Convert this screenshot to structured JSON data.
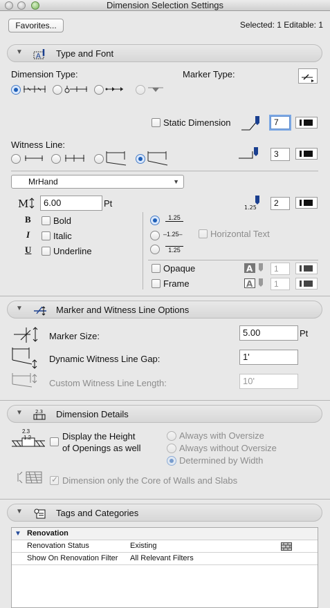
{
  "window": {
    "title": "Dimension Selection Settings"
  },
  "toolbar": {
    "favorites_label": "Favorites...",
    "selection_info": "Selected: 1 Editable: 1"
  },
  "type_font": {
    "title": "Type and Font",
    "dimension_type_label": "Dimension Type:",
    "marker_type_label": "Marker Type:",
    "static_dimension_label": "Static Dimension",
    "static_pen": "7",
    "witness_line_label": "Witness Line:",
    "witness_pen": "3",
    "font_name": "MrHand",
    "font_size": "6.00",
    "font_unit": "Pt",
    "text_pen": "2",
    "bold_label": "Bold",
    "italic_label": "Italic",
    "underline_label": "Underline",
    "sample_value": "1.25",
    "horizontal_text_label": "Horizontal Text",
    "opaque_label": "Opaque",
    "opaque_pen": "1",
    "frame_label": "Frame",
    "frame_pen": "1"
  },
  "marker_options": {
    "title": "Marker and Witness Line Options",
    "marker_size_label": "Marker Size:",
    "marker_size_value": "5.00",
    "marker_size_unit": "Pt",
    "gap_label": "Dynamic Witness Line Gap:",
    "gap_value": "1'",
    "custom_length_label": "Custom Witness Line Length:",
    "custom_length_value": "10'"
  },
  "dimension_details": {
    "title": "Dimension Details",
    "icon_top": "2.3",
    "icon_bottom": "1.2",
    "display_height_line1": "Display the Height",
    "display_height_line2": "of Openings as well",
    "always_with_oversize": "Always with Oversize",
    "always_without_oversize": "Always without Oversize",
    "determined_by_width": "Determined by Width",
    "core_only_label": "Dimension only the Core of Walls and Slabs"
  },
  "tags": {
    "title": "Tags and Categories",
    "group_name": "Renovation",
    "rows": [
      {
        "name": "Renovation Status",
        "value": "Existing"
      },
      {
        "name": "Show On Renovation Filter",
        "value": "All Relevant Filters"
      }
    ]
  }
}
